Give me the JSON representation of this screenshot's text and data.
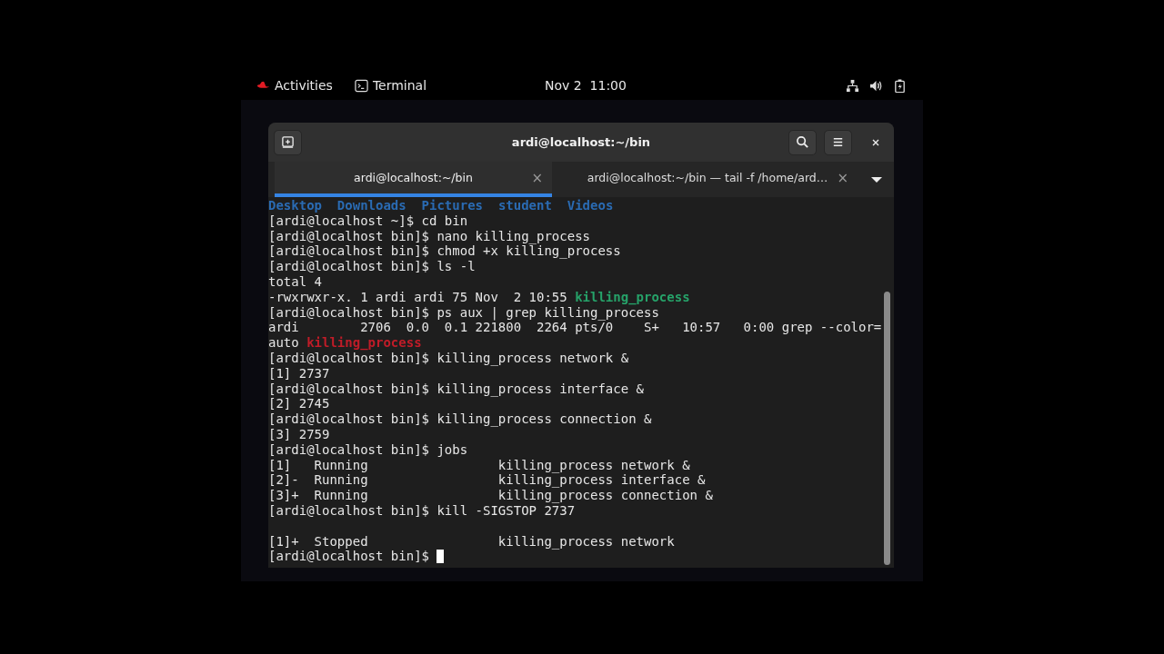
{
  "top_bar": {
    "activities": "Activities",
    "app": "Terminal",
    "clock": "Nov 2  11:00"
  },
  "window": {
    "title": "ardi@localhost:~/bin",
    "tabs": [
      {
        "label": "ardi@localhost:~/bin",
        "close": "×",
        "selected": true
      },
      {
        "label": "ardi@localhost:~/bin — tail -f /home/ard…",
        "close": "×",
        "selected": false
      }
    ],
    "lines": [
      {
        "segments": [
          {
            "text": "Desktop  ",
            "kind": "dir"
          },
          {
            "text": "Downloads  ",
            "kind": "dir"
          },
          {
            "text": "Pictures  ",
            "kind": "dir"
          },
          {
            "text": "student  ",
            "kind": "dir"
          },
          {
            "text": "Videos",
            "kind": "dir"
          }
        ]
      },
      {
        "segments": [
          {
            "text": "[ardi@localhost ~]$ cd bin",
            "kind": "plain"
          }
        ]
      },
      {
        "segments": [
          {
            "text": "[ardi@localhost bin]$ nano killing_process",
            "kind": "plain"
          }
        ]
      },
      {
        "segments": [
          {
            "text": "[ardi@localhost bin]$ chmod +x killing_process",
            "kind": "plain"
          }
        ]
      },
      {
        "segments": [
          {
            "text": "[ardi@localhost bin]$ ls -l",
            "kind": "plain"
          }
        ]
      },
      {
        "segments": [
          {
            "text": "total 4",
            "kind": "plain"
          }
        ]
      },
      {
        "segments": [
          {
            "text": "-rwxrwxr-x. 1 ardi ardi 75 Nov  2 10:55 ",
            "kind": "plain"
          },
          {
            "text": "killing_process",
            "kind": "exec"
          }
        ]
      },
      {
        "segments": [
          {
            "text": "[ardi@localhost bin]$ ps aux | grep killing_process",
            "kind": "plain"
          }
        ]
      },
      {
        "segments": [
          {
            "text": "ardi        2706  0.0  0.1 221800  2264 pts/0    S+   10:57   0:00 grep --color=",
            "kind": "plain"
          }
        ]
      },
      {
        "segments": [
          {
            "text": "auto ",
            "kind": "plain"
          },
          {
            "text": "killing_process",
            "kind": "match"
          }
        ]
      },
      {
        "segments": [
          {
            "text": "[ardi@localhost bin]$ killing_process network &",
            "kind": "plain"
          }
        ]
      },
      {
        "segments": [
          {
            "text": "[1] 2737",
            "kind": "plain"
          }
        ]
      },
      {
        "segments": [
          {
            "text": "[ardi@localhost bin]$ killing_process interface &",
            "kind": "plain"
          }
        ]
      },
      {
        "segments": [
          {
            "text": "[2] 2745",
            "kind": "plain"
          }
        ]
      },
      {
        "segments": [
          {
            "text": "[ardi@localhost bin]$ killing_process connection &",
            "kind": "plain"
          }
        ]
      },
      {
        "segments": [
          {
            "text": "[3] 2759",
            "kind": "plain"
          }
        ]
      },
      {
        "segments": [
          {
            "text": "[ardi@localhost bin]$ jobs",
            "kind": "plain"
          }
        ]
      },
      {
        "segments": [
          {
            "text": "[1]   Running                 killing_process network &",
            "kind": "plain"
          }
        ]
      },
      {
        "segments": [
          {
            "text": "[2]-  Running                 killing_process interface &",
            "kind": "plain"
          }
        ]
      },
      {
        "segments": [
          {
            "text": "[3]+  Running                 killing_process connection &",
            "kind": "plain"
          }
        ]
      },
      {
        "segments": [
          {
            "text": "[ardi@localhost bin]$ kill -SIGSTOP 2737",
            "kind": "plain"
          }
        ]
      },
      {
        "kind": "blank"
      },
      {
        "segments": [
          {
            "text": "[1]+  Stopped                 killing_process network",
            "kind": "plain"
          }
        ]
      },
      {
        "segments": [
          {
            "text": "[ardi@localhost bin]$ ",
            "kind": "plain"
          }
        ],
        "cursor": true
      }
    ]
  }
}
